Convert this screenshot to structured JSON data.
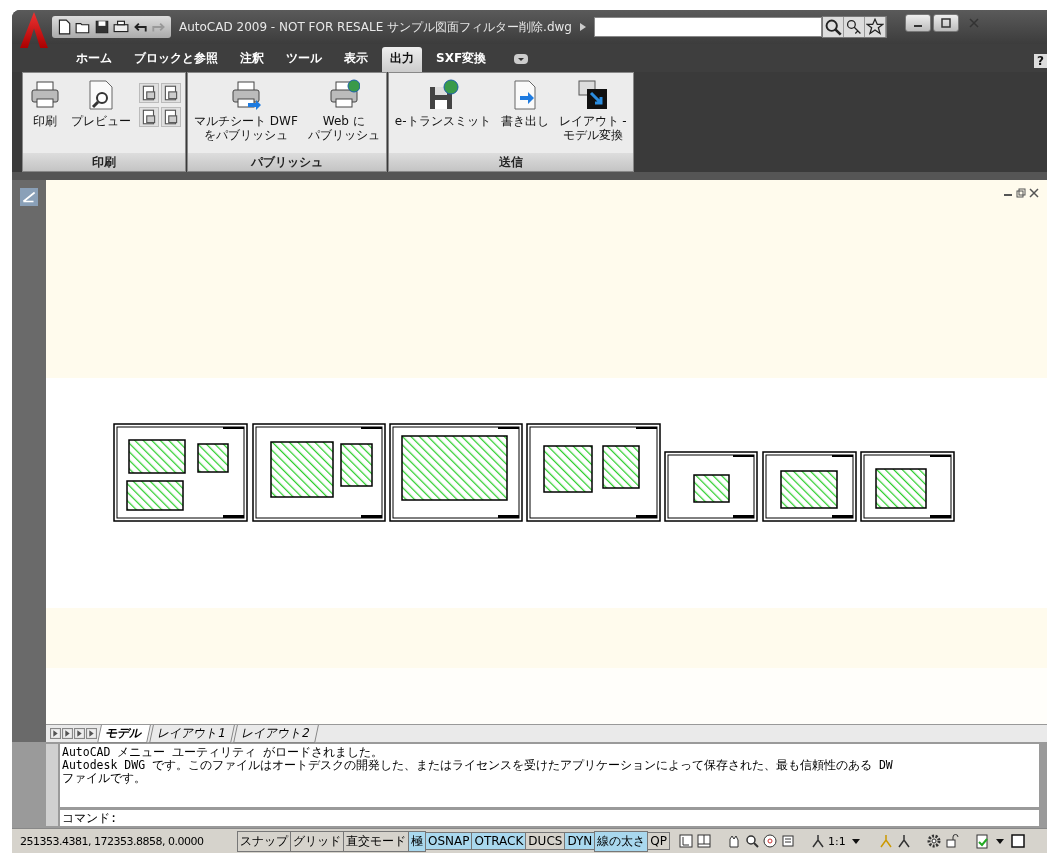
{
  "window": {
    "title": "AutoCAD 2009 - NOT FOR RESALE サンプル図面フィルター削除.dwg"
  },
  "ribbon_tabs": [
    {
      "label": "ホーム",
      "selected": false
    },
    {
      "label": "ブロックと参照",
      "selected": false
    },
    {
      "label": "注釈",
      "selected": false
    },
    {
      "label": "ツール",
      "selected": false
    },
    {
      "label": "表示",
      "selected": false
    },
    {
      "label": "出力",
      "selected": true
    },
    {
      "label": "SXF変換",
      "selected": false
    }
  ],
  "help_button": "?",
  "ribbon_panels": [
    {
      "title": "印刷",
      "buttons": [
        {
          "kind": "printer",
          "lines": [
            "印刷"
          ]
        },
        {
          "kind": "preview",
          "lines": [
            "プレビュー"
          ]
        },
        {
          "kind": "small-grid"
        }
      ]
    },
    {
      "title": "パブリッシュ",
      "buttons": [
        {
          "kind": "publish-dwf",
          "lines": [
            "マルチシート DWF",
            "をパブリッシュ"
          ]
        },
        {
          "kind": "publish-web",
          "lines": [
            "Web に",
            "パブリッシュ"
          ]
        }
      ]
    },
    {
      "title": "送信",
      "buttons": [
        {
          "kind": "etransmit",
          "lines": [
            "e-トランスミット"
          ]
        },
        {
          "kind": "export",
          "lines": [
            "書き出し"
          ]
        },
        {
          "kind": "layout-convert",
          "lines": [
            "レイアウト -",
            "モデル変換"
          ]
        }
      ]
    }
  ],
  "layout_tabs": [
    {
      "label": "モデル",
      "selected": true
    },
    {
      "label": "レイアウト1",
      "selected": false
    },
    {
      "label": "レイアウト2",
      "selected": false
    }
  ],
  "command_history": [
    "AutoCAD メニュー ユーティリティ がロードされました。",
    "Autodesk DWG です。このファイルはオートデスクの開発した、またはライセンスを受けたアプリケーションによって保存された、最も信頼性のある DW",
    "ファイルです。"
  ],
  "command_prompt": "コマンド:",
  "status_bar": {
    "coordinates": "251353.4381, 172353.8858, 0.0000",
    "toggles": [
      {
        "label": "スナップ",
        "on": false
      },
      {
        "label": "グリッド",
        "on": false
      },
      {
        "label": "直交モード",
        "on": false
      },
      {
        "label": "極",
        "on": true
      },
      {
        "label": "OSNAP",
        "on": true
      },
      {
        "label": "OTRACK",
        "on": true
      },
      {
        "label": "DUCS",
        "on": false
      },
      {
        "label": "DYN",
        "on": true
      },
      {
        "label": "線の太さ",
        "on": true
      },
      {
        "label": "QP",
        "on": false
      }
    ],
    "annotation_scale": "1:1"
  }
}
